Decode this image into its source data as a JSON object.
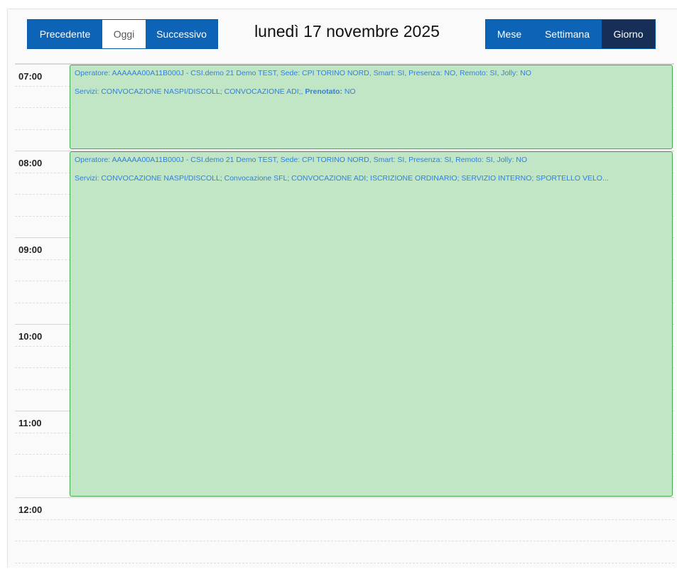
{
  "toolbar": {
    "prev_label": "Precedente",
    "today_label": "Oggi",
    "next_label": "Successivo",
    "title": "lunedì 17 novembre 2025",
    "views": {
      "month": "Mese",
      "week": "Settimana",
      "day": "Giorno"
    },
    "active_view": "Giorno"
  },
  "time_slots": [
    "07:00",
    "",
    "",
    "",
    "08:00",
    "",
    "",
    "",
    "09:00",
    "",
    "",
    "",
    "10:00",
    "",
    "",
    "",
    "11:00",
    "",
    "",
    "",
    "12:00",
    "",
    "",
    ""
  ],
  "events": [
    {
      "line1": "Operatore: AAAAAA00A11B000J - CSI.demo 21 Demo TEST, Sede: CPI TORINO NORD, Smart: SI, Presenza: NO, Remoto: SI, Jolly: NO",
      "line2_prefix": "Servizi: CONVOCAZIONE NASPI/DISCOLL; CONVOCAZIONE ADI;,",
      "line2_bold": "Prenotato:",
      "line2_suffix": "NO"
    },
    {
      "line1": "Operatore: AAAAAA00A11B000J - CSI.demo 21 Demo TEST, Sede: CPI TORINO NORD, Smart: SI, Presenza: SI, Remoto: SI, Jolly: NO",
      "line2": "Servizi: CONVOCAZIONE NASPI/DISCOLL; Convocazione SFL; CONVOCAZIONE ADI; ISCRIZIONE ORDINARIO; SERVIZIO INTERNO; SPORTELLO VELO..."
    }
  ],
  "colors": {
    "primary": "#0d63b5",
    "active": "#172e57",
    "event_bg": "#c1e6c6",
    "event_border": "#45a84e",
    "event_text": "#2f7fe6"
  }
}
